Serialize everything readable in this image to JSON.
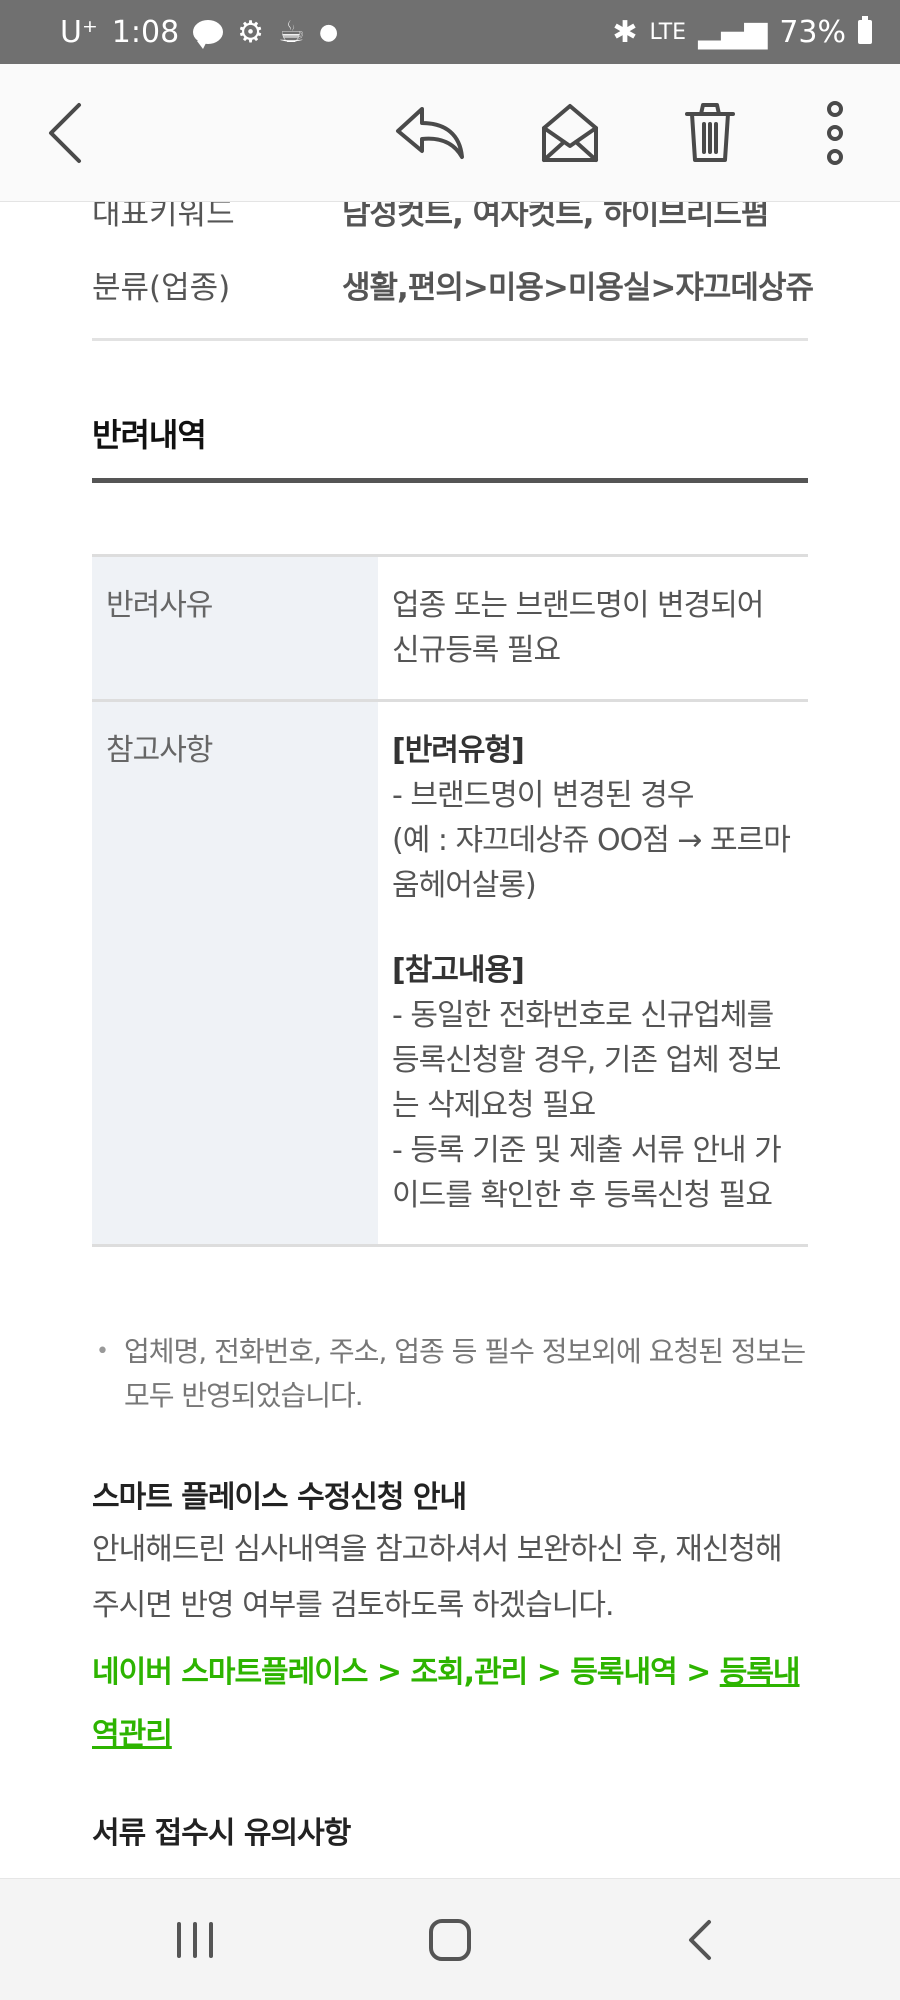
{
  "status_bar": {
    "carrier": "U⁺",
    "time": "1:08",
    "network": "LTE",
    "battery": "73%"
  },
  "info_rows": [
    {
      "label": "대표키워드",
      "value": "남성컷트, 여자컷트, 하이브리드펌"
    },
    {
      "label": "분류(업종)",
      "value": "생활,편의>미용>미용실>쟈끄데상쥬"
    }
  ],
  "rejection": {
    "title": "반려내역",
    "reason_label": "반려사유",
    "reason_value": "업종 또는 브랜드명이 변경되어 신규등록 필요",
    "notes_label": "참고사항",
    "type_heading": "[반려유형]",
    "type_line1": "- 브랜드명이 변경된 경우",
    "type_line2": "(예 : 쟈끄데상쥬 OO점 → 포르마움헤어살롱)",
    "ref_heading": "[참고내용]",
    "ref_line1": "- 동일한 전화번호로 신규업체를 등록신청할 경우, 기존 업체 정보는 삭제요청 필요",
    "ref_line2": "- 등록 기준 및 제출 서류 안내 가이드를 확인한 후 등록신청 필요"
  },
  "note": "업체명, 전화번호, 주소, 업종 등 필수 정보외에 요청된 정보는 모두 반영되었습니다.",
  "smart_place": {
    "title": "스마트 플레이스 수정신청 안내",
    "body": "안내해드린 심사내역을 참고하셔서 보완하신 후, 재신청해 주시면 반영 여부를 검토하도록 하겠습니다.",
    "path_text": "네이버 스마트플레이스 > 조회,관리 > 등록내역 > ",
    "path_link": "등록내역관리"
  },
  "docs_title": "서류 접수시 유의사항"
}
